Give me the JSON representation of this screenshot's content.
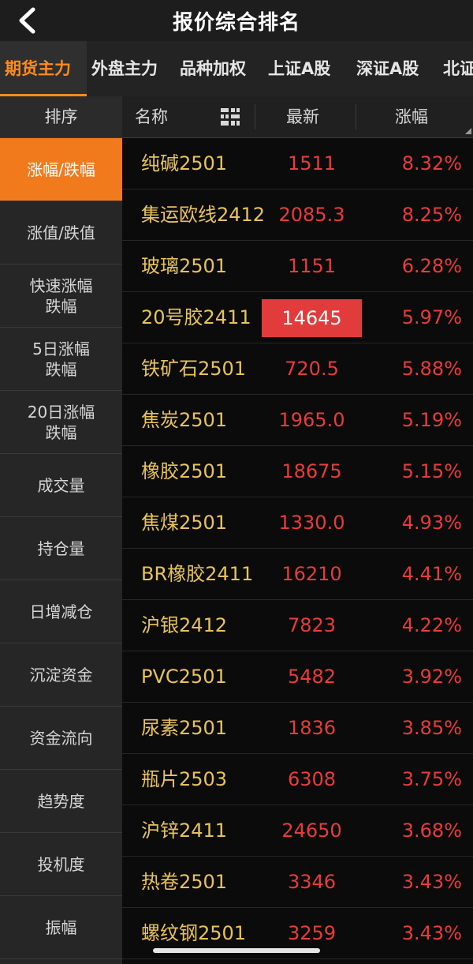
{
  "header": {
    "title": "报价综合排名",
    "back_icon": "chevron-left-icon"
  },
  "tabs": [
    "期货主力",
    "外盘主力",
    "品种加权",
    "上证A股",
    "深证A股",
    "北证"
  ],
  "active_tab": 0,
  "sidebar": {
    "header": "排序",
    "items": [
      "涨幅/跌幅",
      "涨值/跌值",
      "快速涨幅\n跌幅",
      "5日涨幅\n跌幅",
      "20日涨幅\n跌幅",
      "成交量",
      "持仓量",
      "日增减仓",
      "沉淀资金",
      "资金流向",
      "趋势度",
      "投机度",
      "振幅"
    ],
    "active_index": 0
  },
  "table": {
    "columns": {
      "name": "名称",
      "latest": "最新",
      "change": "涨幅"
    },
    "rows": [
      {
        "name": "纯碱2501",
        "price": "1511",
        "change": "8.32%"
      },
      {
        "name": "集运欧线2412",
        "price": "2085.3",
        "change": "8.25%"
      },
      {
        "name": "玻璃2501",
        "price": "1151",
        "change": "6.28%"
      },
      {
        "name": "20号胶2411",
        "price": "14645",
        "change": "5.97%"
      },
      {
        "name": "铁矿石2501",
        "price": "720.5",
        "change": "5.88%"
      },
      {
        "name": "焦炭2501",
        "price": "1965.0",
        "change": "5.19%"
      },
      {
        "name": "橡胶2501",
        "price": "18675",
        "change": "5.15%"
      },
      {
        "name": "焦煤2501",
        "price": "1330.0",
        "change": "4.93%"
      },
      {
        "name": "BR橡胶2411",
        "price": "16210",
        "change": "4.41%"
      },
      {
        "name": "沪银2412",
        "price": "7823",
        "change": "4.22%"
      },
      {
        "name": "PVC2501",
        "price": "5482",
        "change": "3.92%"
      },
      {
        "name": "尿素2501",
        "price": "1836",
        "change": "3.85%"
      },
      {
        "name": "瓶片2503",
        "price": "6308",
        "change": "3.75%"
      },
      {
        "name": "沪锌2411",
        "price": "24650",
        "change": "3.68%"
      },
      {
        "name": "热卷2501",
        "price": "3346",
        "change": "3.43%"
      },
      {
        "name": "螺纹钢2501",
        "price": "3259",
        "change": "3.43%"
      }
    ],
    "highlighted_row": 3
  },
  "colors": {
    "accent": "#f07a1c",
    "up": "#e83b3b",
    "name": "#e8c25a"
  }
}
